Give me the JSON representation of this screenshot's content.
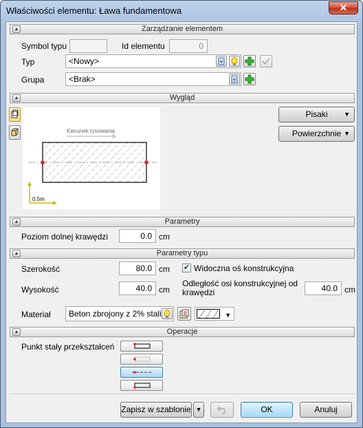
{
  "window": {
    "title": "Właściwości elementu: Ława fundamentowa",
    "close_glyph": "✕"
  },
  "sections": {
    "management": "Zarządzanie elementem",
    "appearance": "Wygląd",
    "parameters": "Parametry",
    "type_parameters": "Parametry typu",
    "operations": "Operacje"
  },
  "management": {
    "symbol_label": "Symbol typu",
    "symbol_value": "",
    "id_label": "Id elementu",
    "id_value": "0",
    "type_label": "Typ",
    "type_value": "<Nowy>",
    "group_label": "Grupa",
    "group_value": "<Brak>"
  },
  "appearance": {
    "preview_arrow_label": "Kierunek rysowania",
    "scale_label": "0.5m",
    "pens_button": "Pisaki",
    "surfaces_button": "Powierzchnie"
  },
  "parameters": {
    "bottom_edge_label": "Poziom dolnej krawędzi",
    "bottom_edge_value": "0.0",
    "unit": "cm"
  },
  "type_parameters": {
    "width_label": "Szerokość",
    "width_value": "80.0",
    "height_label": "Wysokość",
    "height_value": "40.0",
    "unit": "cm",
    "axis_visible_label": "Widoczna oś konstrukcyjna",
    "axis_visible_checked": true,
    "axis_distance_label": "Odległość osi konstrukcyjnej od krawędzi",
    "axis_distance_value": "40.0",
    "material_label": "Materiał",
    "material_value": "Beton zbrojony z 2% stali"
  },
  "operations": {
    "fixed_point_label": "Punkt stały przekształceń",
    "selected_index": 2
  },
  "footer": {
    "save_template": "Zapisz w szablonie",
    "ok": "OK",
    "cancel": "Anuluj"
  },
  "colors": {
    "accent_green": "#2e9e2e",
    "axis_red": "#e02020",
    "scale_yellow": "#d4b800"
  }
}
